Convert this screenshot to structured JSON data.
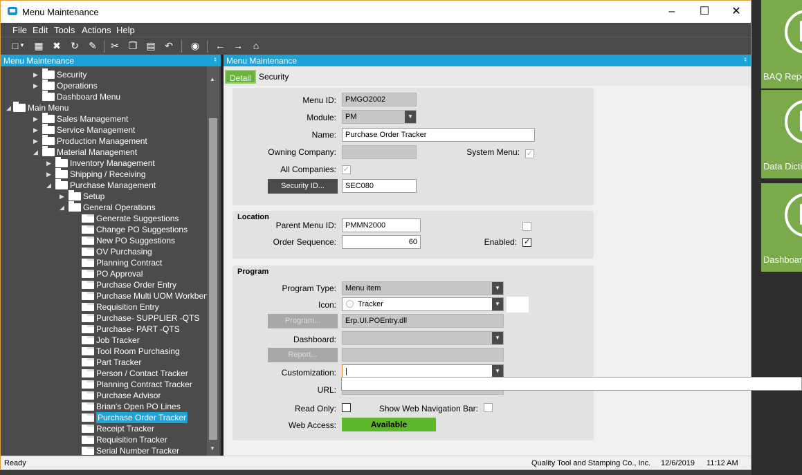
{
  "window": {
    "title": "Menu Maintenance"
  },
  "menubar": [
    "File",
    "Edit",
    "Tools",
    "Actions",
    "Help"
  ],
  "side_tiles": [
    {
      "label": "BAQ Repo"
    },
    {
      "label": "Data Dicti"
    },
    {
      "label": "Dashboar"
    }
  ],
  "left_panel": {
    "title": "Menu Maintenance",
    "tree": [
      {
        "label": "Security",
        "level": 1,
        "state": "collapsed"
      },
      {
        "label": "Operations",
        "level": 1,
        "state": "collapsed"
      },
      {
        "label": "Dashboard Menu",
        "level": 1,
        "state": "leaf-folder"
      },
      {
        "label": "Main Menu",
        "level": 0,
        "state": "expanded"
      },
      {
        "label": "Sales Management",
        "level": 1,
        "state": "collapsed"
      },
      {
        "label": "Service Management",
        "level": 1,
        "state": "collapsed"
      },
      {
        "label": "Production Management",
        "level": 1,
        "state": "collapsed"
      },
      {
        "label": "Material Management",
        "level": 1,
        "state": "expanded"
      },
      {
        "label": "Inventory Management",
        "level": 2,
        "state": "collapsed"
      },
      {
        "label": "Shipping / Receiving",
        "level": 2,
        "state": "collapsed"
      },
      {
        "label": "Purchase Management",
        "level": 2,
        "state": "expanded"
      },
      {
        "label": "Setup",
        "level": 3,
        "state": "collapsed"
      },
      {
        "label": "General Operations",
        "level": 3,
        "state": "expanded"
      },
      {
        "label": "Generate Suggestions",
        "level": 4,
        "state": "item"
      },
      {
        "label": "Change PO Suggestions",
        "level": 4,
        "state": "item"
      },
      {
        "label": "New PO Suggestions",
        "level": 4,
        "state": "item"
      },
      {
        "label": "OV Purchasing",
        "level": 4,
        "state": "item"
      },
      {
        "label": "Planning Contract",
        "level": 4,
        "state": "item"
      },
      {
        "label": "PO Approval",
        "level": 4,
        "state": "item"
      },
      {
        "label": "Purchase Order Entry",
        "level": 4,
        "state": "item"
      },
      {
        "label": "Purchase Multi UOM Workbench",
        "level": 4,
        "state": "item"
      },
      {
        "label": "Requisition Entry",
        "level": 4,
        "state": "item"
      },
      {
        "label": "Purchase- SUPPLIER -QTS",
        "level": 4,
        "state": "item"
      },
      {
        "label": "Purchase- PART -QTS",
        "level": 4,
        "state": "item"
      },
      {
        "label": "Job Tracker",
        "level": 4,
        "state": "item"
      },
      {
        "label": "Tool Room Purchasing",
        "level": 4,
        "state": "item"
      },
      {
        "label": "Part Tracker",
        "level": 4,
        "state": "item"
      },
      {
        "label": "Person / Contact Tracker",
        "level": 4,
        "state": "item"
      },
      {
        "label": "Planning Contract Tracker",
        "level": 4,
        "state": "item"
      },
      {
        "label": "Purchase Advisor",
        "level": 4,
        "state": "item"
      },
      {
        "label": "Brian's Open PO Lines",
        "level": 4,
        "state": "item"
      },
      {
        "label": "Purchase Order Tracker",
        "level": 4,
        "state": "item",
        "selected": true
      },
      {
        "label": "Receipt Tracker",
        "level": 4,
        "state": "item"
      },
      {
        "label": "Requisition Tracker",
        "level": 4,
        "state": "item"
      },
      {
        "label": "Serial Number Tracker",
        "level": 4,
        "state": "item"
      }
    ]
  },
  "right_panel": {
    "title": "Menu Maintenance",
    "tabs": [
      "Detail",
      "Security"
    ],
    "detail": {
      "menu_id_label": "Menu ID:",
      "menu_id": "PMGO2002",
      "module_label": "Module:",
      "module": "PM",
      "name_label": "Name:",
      "name": "Purchase Order Tracker",
      "owning_company_label": "Owning Company:",
      "owning_company": "",
      "system_menu_label": "System Menu:",
      "system_menu": true,
      "all_companies_label": "All Companies:",
      "all_companies": true,
      "security_id_button": "Security ID...",
      "security_id": "SEC080"
    },
    "location": {
      "title": "Location",
      "parent_menu_id_label": "Parent Menu ID:",
      "parent_menu_id": "PMMN2000",
      "order_sequence_label": "Order Sequence:",
      "order_sequence": "60",
      "enabled_label": "Enabled:",
      "enabled": true
    },
    "program": {
      "title": "Program",
      "program_type_label": "Program Type:",
      "program_type": "Menu item",
      "icon_label": "Icon:",
      "icon": "Tracker",
      "program_button": "Program...",
      "program": "Erp.UI.POEntry.dll",
      "dashboard_label": "Dashboard:",
      "dashboard": "",
      "report_button": "Report...",
      "report": "",
      "customization_label": "Customization:",
      "customization": "|",
      "url_label": "URL:",
      "url": "",
      "read_only_label": "Read Only:",
      "read_only": false,
      "show_web_nav_label": "Show Web Navigation Bar:",
      "show_web_nav": false,
      "web_access_label": "Web Access:",
      "web_access": "Available"
    }
  },
  "status": {
    "left": "Ready",
    "company": "Quality Tool and Stamping Co., Inc.",
    "date": "12/6/2019",
    "time": "11:12 AM"
  }
}
